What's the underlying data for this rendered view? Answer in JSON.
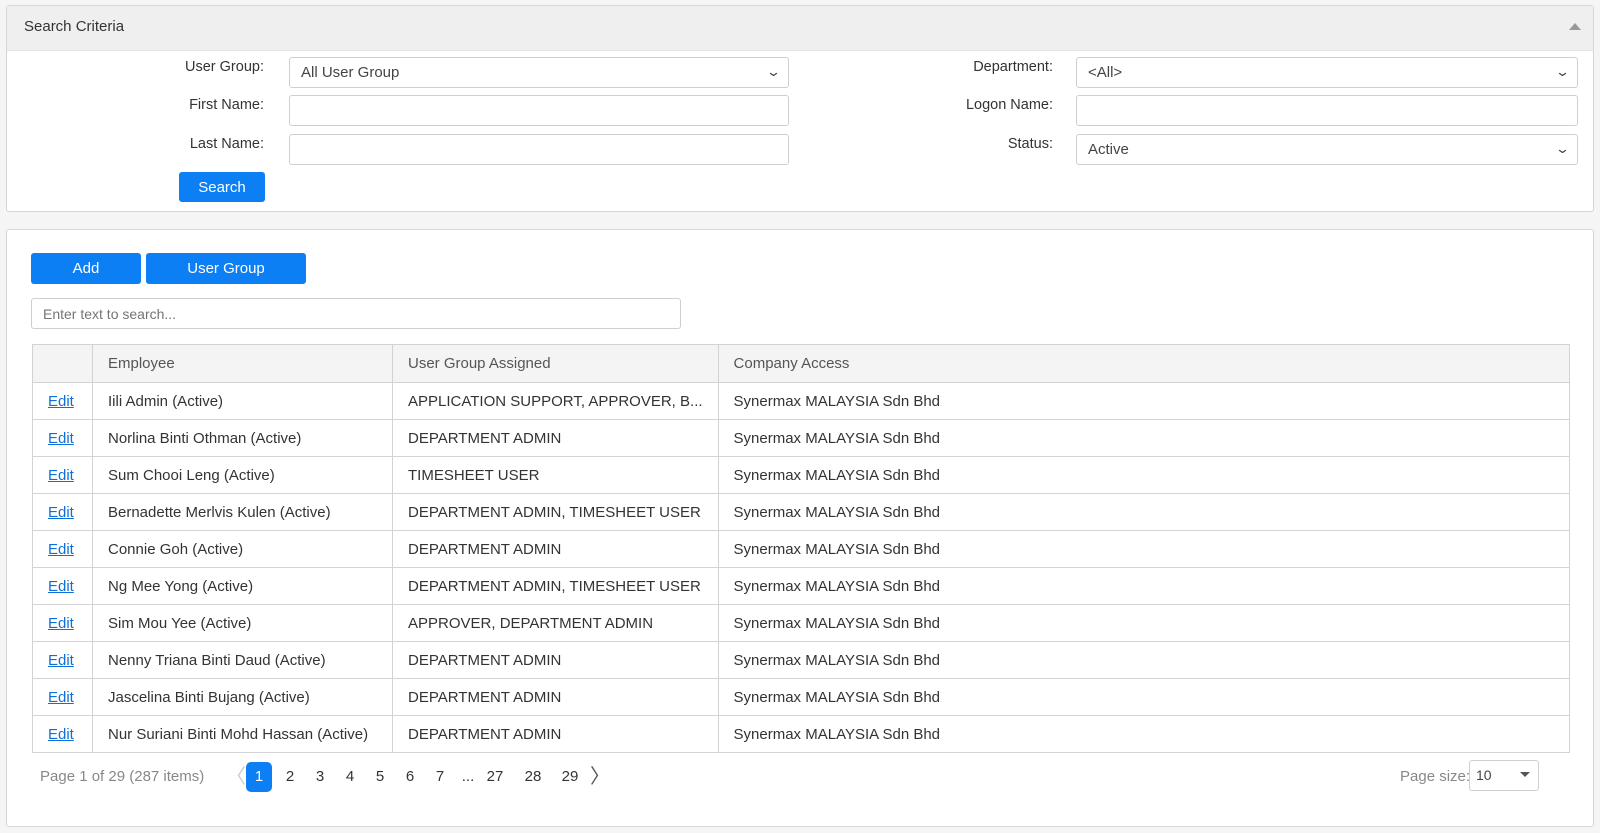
{
  "search_panel": {
    "title": "Search Criteria",
    "user_group_label": "User Group:",
    "user_group_value": "All User Group",
    "first_name_label": "First Name:",
    "first_name_value": "",
    "last_name_label": "Last Name:",
    "last_name_value": "",
    "department_label": "Department:",
    "department_value": "<All>",
    "logon_name_label": "Logon Name:",
    "logon_name_value": "",
    "status_label": "Status:",
    "status_value": "Active",
    "search_button": "Search"
  },
  "list_panel": {
    "add_button": "Add",
    "user_group_button": "User Group",
    "search_placeholder": "Enter text to search...",
    "columns": [
      "",
      "Employee",
      "User Group Assigned",
      "Company Access"
    ],
    "rows": [
      {
        "action": "Edit",
        "employee": "Iili Admin (Active)",
        "group": "APPLICATION SUPPORT, APPROVER, B...",
        "company": "Synermax MALAYSIA Sdn Bhd"
      },
      {
        "action": "Edit",
        "employee": "Norlina Binti Othman (Active)",
        "group": "DEPARTMENT ADMIN",
        "company": "Synermax MALAYSIA Sdn Bhd"
      },
      {
        "action": "Edit",
        "employee": "Sum Chooi Leng (Active)",
        "group": "TIMESHEET USER",
        "company": "Synermax MALAYSIA Sdn Bhd"
      },
      {
        "action": "Edit",
        "employee": "Bernadette Merlvis Kulen (Active)",
        "group": "DEPARTMENT ADMIN, TIMESHEET USER",
        "company": "Synermax MALAYSIA Sdn Bhd"
      },
      {
        "action": "Edit",
        "employee": "Connie Goh (Active)",
        "group": "DEPARTMENT ADMIN",
        "company": "Synermax MALAYSIA Sdn Bhd"
      },
      {
        "action": "Edit",
        "employee": "Ng Mee Yong (Active)",
        "group": "DEPARTMENT ADMIN, TIMESHEET USER",
        "company": "Synermax MALAYSIA Sdn Bhd"
      },
      {
        "action": "Edit",
        "employee": "Sim Mou Yee (Active)",
        "group": "APPROVER, DEPARTMENT ADMIN",
        "company": "Synermax MALAYSIA Sdn Bhd"
      },
      {
        "action": "Edit",
        "employee": "Nenny Triana Binti Daud (Active)",
        "group": "DEPARTMENT ADMIN",
        "company": "Synermax MALAYSIA Sdn Bhd"
      },
      {
        "action": "Edit",
        "employee": "Jascelina Binti Bujang (Active)",
        "group": "DEPARTMENT ADMIN",
        "company": "Synermax MALAYSIA Sdn Bhd"
      },
      {
        "action": "Edit",
        "employee": "Nur Suriani Binti Mohd Hassan (Active)",
        "group": "DEPARTMENT ADMIN",
        "company": "Synermax MALAYSIA Sdn Bhd"
      }
    ],
    "pager": {
      "summary": "Page 1 of 29 (287 items)",
      "pages": [
        "1",
        "2",
        "3",
        "4",
        "5",
        "6",
        "7",
        "...",
        "27",
        "28",
        "29"
      ],
      "current": "1",
      "page_size_label": "Page size:",
      "page_size": "10"
    }
  },
  "colors": {
    "accent": "#0d7ff5",
    "link": "#0d6fd8"
  }
}
